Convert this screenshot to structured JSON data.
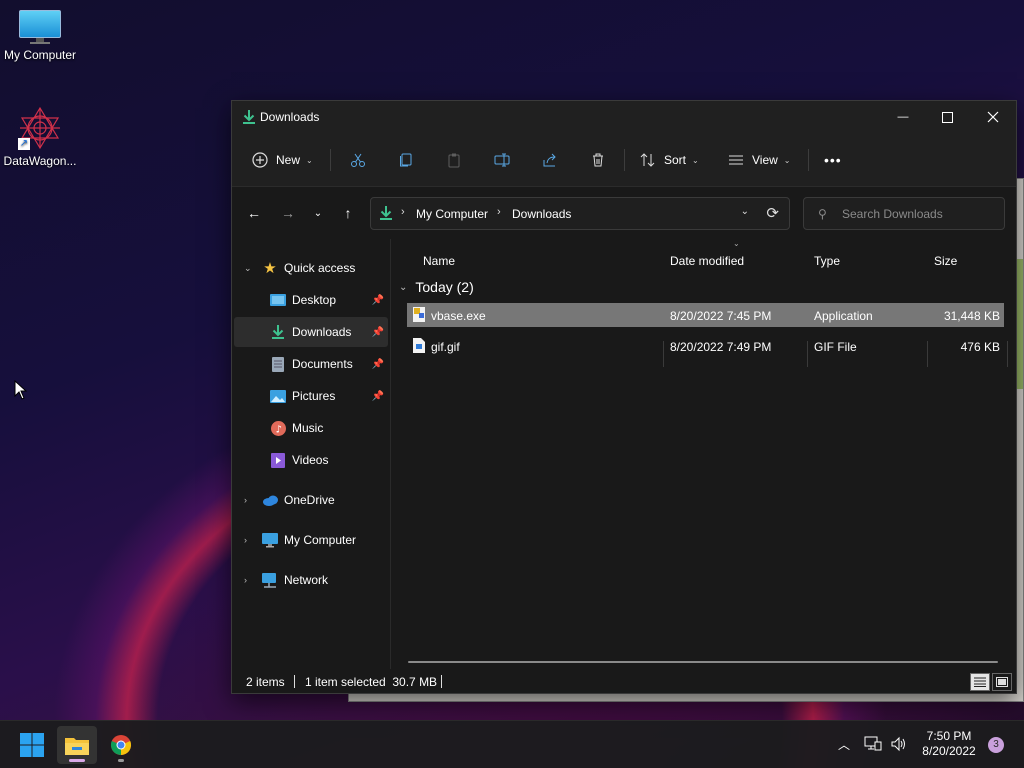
{
  "desktop": {
    "icons": [
      {
        "label": "My Computer",
        "icon": "monitor-icon"
      },
      {
        "label": "DataWagon...",
        "icon": "datawagon-logo-icon"
      }
    ]
  },
  "window": {
    "title": "Downloads",
    "controls": {
      "minimize": "—",
      "maximize": "☐",
      "close": "✕"
    }
  },
  "toolbar": {
    "new_label": "New",
    "sort_label": "Sort",
    "view_label": "View",
    "more_label": "•••"
  },
  "address": {
    "crumbs": [
      "My Computer",
      "Downloads"
    ],
    "separator": "›"
  },
  "search": {
    "placeholder": "Search Downloads"
  },
  "sidebar": {
    "items": [
      {
        "label": "Quick access",
        "icon": "star-icon",
        "color": "#f6c443"
      },
      {
        "label": "Desktop",
        "icon": "desktop-folder-icon",
        "color": "#3aa0e0",
        "pinned": true
      },
      {
        "label": "Downloads",
        "icon": "download-icon",
        "color": "#3ec28f",
        "pinned": true,
        "selected": true
      },
      {
        "label": "Documents",
        "icon": "document-icon",
        "color": "#9aa8b8",
        "pinned": true
      },
      {
        "label": "Pictures",
        "icon": "pictures-icon",
        "color": "#3aa0e0",
        "pinned": true
      },
      {
        "label": "Music",
        "icon": "music-icon",
        "color": "#e06a5a"
      },
      {
        "label": "Videos",
        "icon": "videos-icon",
        "color": "#8a5ad8"
      },
      {
        "label": "OneDrive",
        "icon": "cloud-icon",
        "color": "#2e86de"
      },
      {
        "label": "My Computer",
        "icon": "computer-icon",
        "color": "#3aa0e0"
      },
      {
        "label": "Network",
        "icon": "network-icon",
        "color": "#3aa0e0"
      }
    ]
  },
  "table": {
    "columns": [
      "Name",
      "Date modified",
      "Type",
      "Size"
    ],
    "group": "Today (2)",
    "rows": [
      {
        "name": "vbase.exe",
        "date": "8/20/2022 7:45 PM",
        "type": "Application",
        "size": "31,448 KB",
        "selected": true
      },
      {
        "name": "gif.gif",
        "date": "8/20/2022 7:49 PM",
        "type": "GIF File",
        "size": "476 KB",
        "selected": false
      }
    ]
  },
  "status": {
    "items": "2 items",
    "selected": "1 item selected  30.7 MB"
  },
  "taskbar": {
    "apps": [
      "start-button",
      "file-explorer",
      "chrome"
    ],
    "clock_time": "7:50 PM",
    "clock_date": "8/20/2022",
    "notifications": "3"
  }
}
